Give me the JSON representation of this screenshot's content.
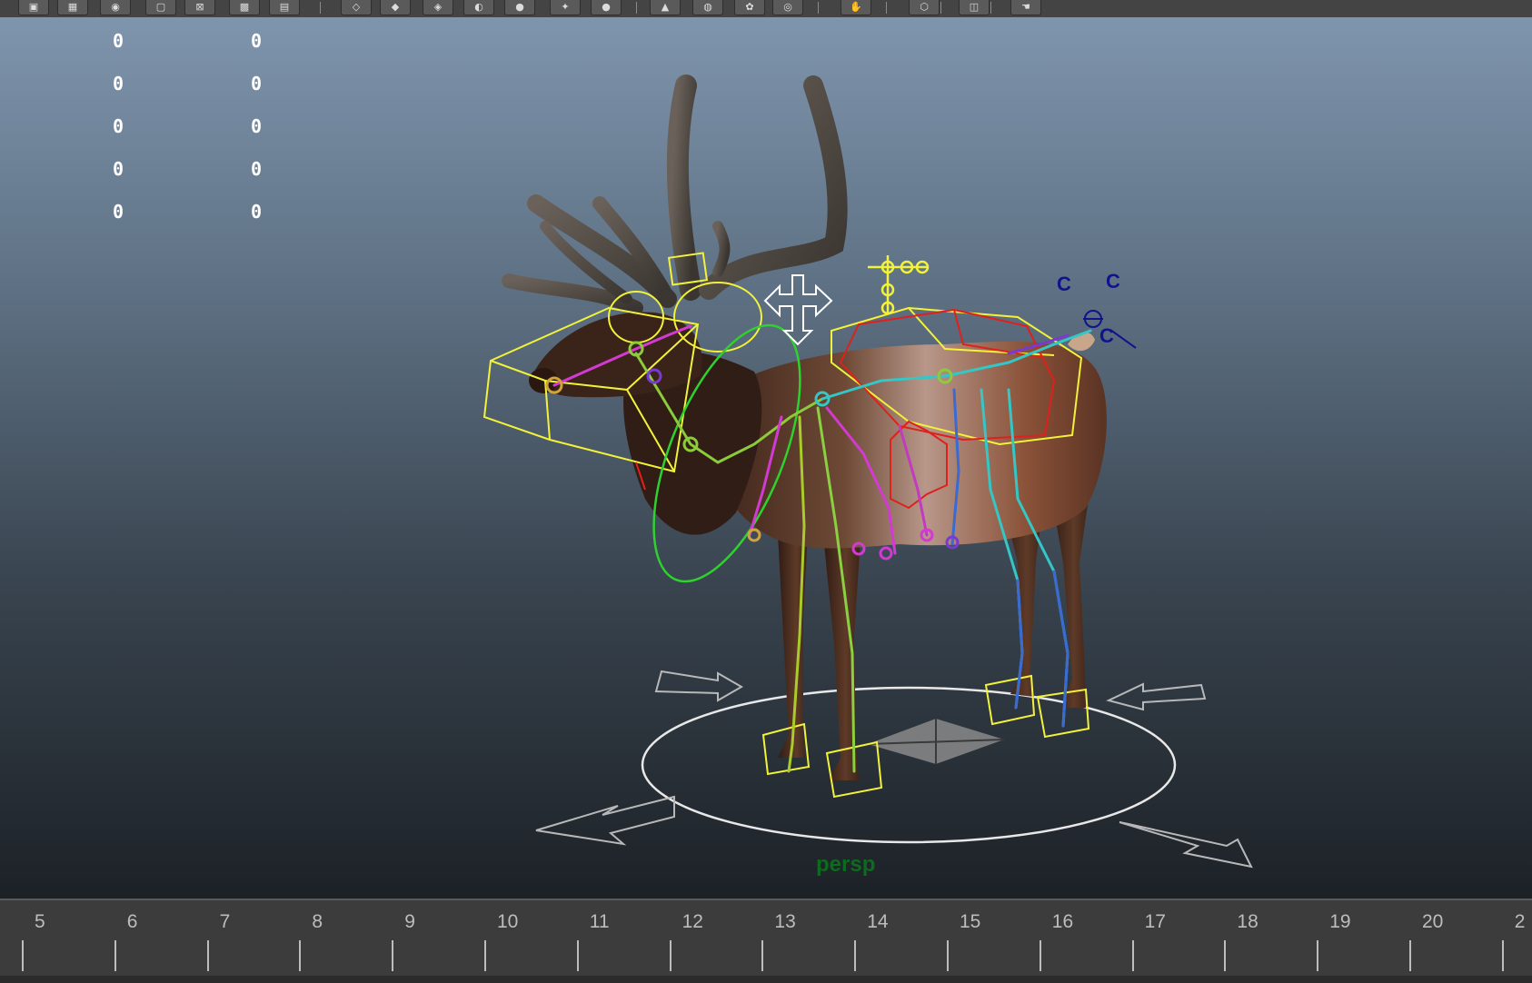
{
  "toolbar": {
    "buttons": [
      {
        "icon": "select-icon",
        "glyph": "▣"
      },
      {
        "icon": "grid-icon",
        "glyph": "▦"
      },
      {
        "icon": "camera-icon",
        "glyph": "◉"
      },
      {
        "icon": "film-gate-icon",
        "glyph": "▢"
      },
      {
        "icon": "resolution-gate-icon",
        "glyph": "⊠"
      },
      {
        "icon": "field-chart-icon",
        "glyph": "▩"
      },
      {
        "icon": "safe-action-icon",
        "glyph": "▤"
      },
      {
        "icon": "wireframe-icon",
        "glyph": "◇"
      },
      {
        "icon": "smooth-shade-icon",
        "glyph": "◆"
      },
      {
        "icon": "wireframe-on-shaded-icon",
        "glyph": "◈"
      },
      {
        "icon": "xray-icon",
        "glyph": "◐"
      },
      {
        "icon": "default-light-icon",
        "glyph": "●"
      },
      {
        "icon": "all-lights-icon",
        "glyph": "✦"
      },
      {
        "icon": "shadows-icon",
        "glyph": "●"
      },
      {
        "icon": "textured-icon",
        "glyph": "▲"
      },
      {
        "icon": "high-quality-icon",
        "glyph": "◍"
      },
      {
        "icon": "ambient-occlusion-icon",
        "glyph": "✿"
      },
      {
        "icon": "anti-alias-icon",
        "glyph": "◎"
      },
      {
        "icon": "isolate-select-icon",
        "glyph": "✋"
      },
      {
        "icon": "xray-joints-icon",
        "glyph": "⬡"
      },
      {
        "icon": "cube-icon",
        "glyph": "◫"
      },
      {
        "icon": "hand-icon",
        "glyph": "☚"
      }
    ]
  },
  "viewport": {
    "hud": {
      "left": [
        "0",
        "0",
        "0",
        "0",
        "0"
      ],
      "right": [
        "0",
        "0",
        "0",
        "0",
        "0"
      ]
    },
    "camera_label": "persp",
    "control_labels": [
      "C",
      "C",
      "C"
    ]
  },
  "timeline": {
    "frames": [
      "5",
      "6",
      "7",
      "8",
      "9",
      "10",
      "11",
      "12",
      "13",
      "14",
      "15",
      "16",
      "17",
      "18",
      "19",
      "20",
      "2"
    ]
  },
  "colors": {
    "control_yellow": "#f2f23a",
    "control_red": "#e0201c",
    "control_green": "#2fd12f",
    "joint_magenta": "#d23ad2",
    "joint_cyan": "#35c6c6",
    "joint_blue": "#3a6ad2",
    "label_blue": "#10148a"
  }
}
